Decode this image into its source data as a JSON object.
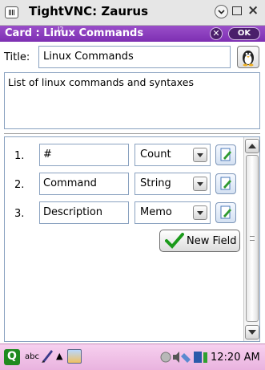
{
  "vnc": {
    "title": "TightVNC: Zaurus",
    "buttons": [
      "⌄",
      "□",
      "×"
    ]
  },
  "window": {
    "title": "Card : Linux Commands",
    "cursor_mark": "I2",
    "close_label": "✕",
    "ok_label": "OK"
  },
  "form": {
    "title_label": "Title:",
    "title_value": "Linux Commands",
    "description": "List of linux commands and syntaxes"
  },
  "fields": [
    {
      "num": "1.",
      "name": "#",
      "type": "Count"
    },
    {
      "num": "2.",
      "name": "Command",
      "type": "String"
    },
    {
      "num": "3.",
      "name": "Description",
      "type": "Memo"
    }
  ],
  "new_field_label": "New Field",
  "taskbar": {
    "q_label": "Q",
    "abc_label": "abc",
    "arrow": "▲",
    "time": "12:20 AM"
  },
  "colors": {
    "window_header": "#8a3cbf",
    "taskbar": "#f0c0e8",
    "field_border": "#8aa2c0",
    "check_green": "#1a9a1a"
  }
}
